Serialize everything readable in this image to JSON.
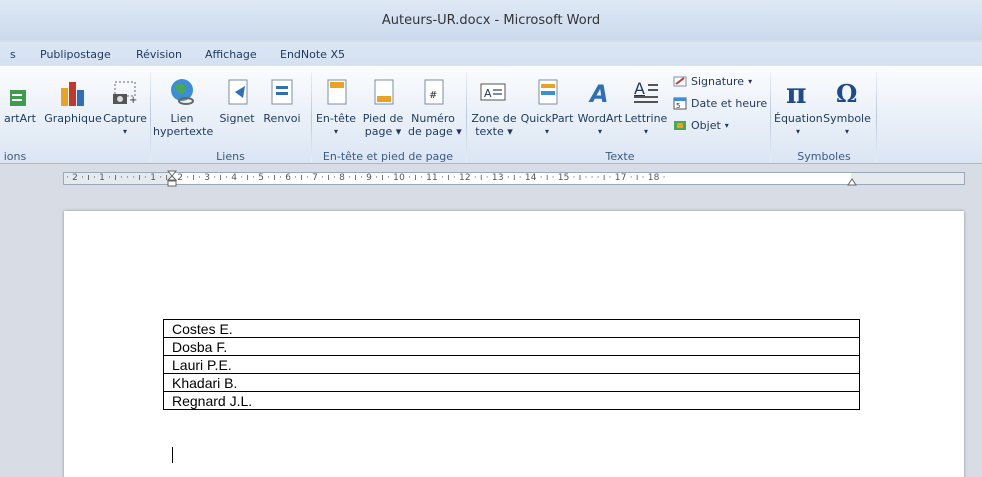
{
  "window": {
    "title": "Auteurs-UR.docx - Microsoft Word"
  },
  "tabs": [
    "s",
    "Publipostage",
    "Révision",
    "Affichage",
    "EndNote X5"
  ],
  "ribbon": {
    "partial_button": "artArt",
    "illustrations_group_label": "ions",
    "graphique": "Graphique",
    "capture": "Capture",
    "lien_line1": "Lien",
    "lien_line2": "hypertexte",
    "signet": "Signet",
    "renvoi": "Renvoi",
    "liens_group_label": "Liens",
    "entete": "En-tête",
    "pied_line1": "Pied de",
    "pied_line2": "page",
    "numero_line1": "Numéro",
    "numero_line2": "de page",
    "header_footer_group_label": "En-tête et pied de page",
    "zone_line1": "Zone de",
    "zone_line2": "texte",
    "quickpart": "QuickPart",
    "wordart": "WordArt",
    "lettrine": "Lettrine",
    "signature": "Signature",
    "date_heure": "Date et heure",
    "objet": "Objet",
    "texte_group_label": "Texte",
    "equation": "Équation",
    "symbole": "Symbole",
    "symboles_group_label": "Symboles"
  },
  "ruler": {
    "text": "· 2 · ı · 1 · ı ·  ·  · ı · 1 · ı · 2 · ı · 3 · ı · 4 · ı · 5 · ı · 6 · ı · 7 · ı · 8 · ı · 9 · ı · 10 · ı · 11 · ı · 12 · ı · 13 · ı · 14 · ı · 15 · ı ·  ·  · ı · 17 · ı · 18 ·"
  },
  "document": {
    "authors": [
      "Costes E.",
      "Dosba F.",
      "Lauri P.E.",
      "Khadari B.",
      "Regnard J.L."
    ]
  },
  "colors": {
    "ribbon_text": "#1e395b",
    "page": "#ffffff",
    "workspace": "#d8dde5"
  }
}
